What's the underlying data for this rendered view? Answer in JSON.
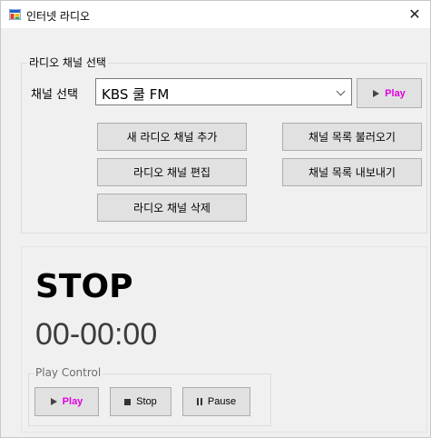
{
  "window": {
    "title": "인터넷 라디오",
    "close_glyph": "✕"
  },
  "channel_group": {
    "label": "라디오 채널 선택",
    "select_label": "채널 선택",
    "selected_channel": "KBS 쿨 FM",
    "play_label": "Play",
    "buttons": {
      "add": "새 라디오 채널 추가",
      "edit": "라디오 채널 편집",
      "delete": "라디오 채널 삭제",
      "import": "채널 목록 불러오기",
      "export": "채널 목록 내보내기"
    }
  },
  "status": {
    "state": "STOP",
    "time": "00-00:00"
  },
  "play_control": {
    "label": "Play Control",
    "play": "Play",
    "stop": "Stop",
    "pause": "Pause"
  },
  "colors": {
    "play_text": "#e000e0",
    "window_bg": "#f0f0f0",
    "button_bg": "#e1e1e1"
  },
  "icons": [
    "app-icon",
    "close-icon",
    "dropdown-chevron-icon",
    "play-icon",
    "stop-icon",
    "pause-icon"
  ]
}
